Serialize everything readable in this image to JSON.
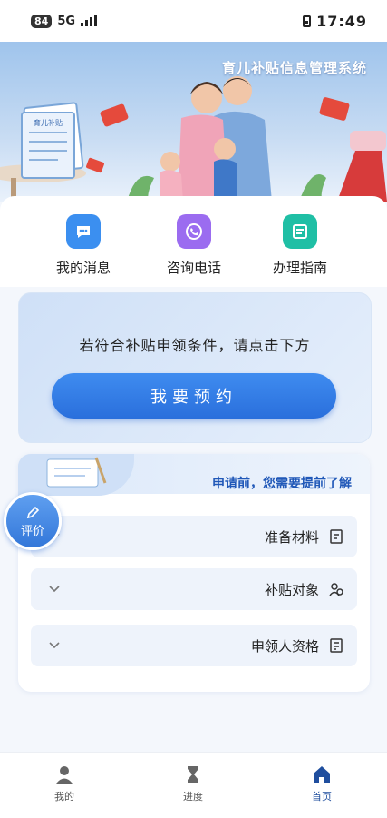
{
  "status_bar": {
    "battery": "84",
    "network": "5G",
    "time": "17:49"
  },
  "banner": {
    "title": "育儿补贴信息管理系统",
    "doc_label": "育儿补贴"
  },
  "quick_actions": [
    {
      "label": "办理指南",
      "icon": "guide-icon",
      "color": "#1fbfa5"
    },
    {
      "label": "咨询电话",
      "icon": "phone-icon",
      "color": "#9b6cf0"
    },
    {
      "label": "我的消息",
      "icon": "message-icon",
      "color": "#3b8ff0"
    }
  ],
  "apply": {
    "prompt": "若符合补贴申领条件，请点击下方",
    "button_label": "我要预约"
  },
  "info": {
    "title": "申请前，您需要提前了解",
    "items": [
      {
        "label": "准备材料",
        "icon": "document-icon"
      },
      {
        "label": "补贴对象",
        "icon": "people-icon"
      },
      {
        "label": "申领人资格",
        "icon": "checklist-icon"
      }
    ]
  },
  "rate_button": "评价",
  "tabbar": [
    {
      "label": "首页",
      "icon": "home-icon"
    },
    {
      "label": "进度",
      "icon": "hourglass-icon"
    },
    {
      "label": "我的",
      "icon": "user-icon"
    }
  ],
  "colors": {
    "primary": "#2a6fdc",
    "active_tab": "#1f4e9e"
  }
}
